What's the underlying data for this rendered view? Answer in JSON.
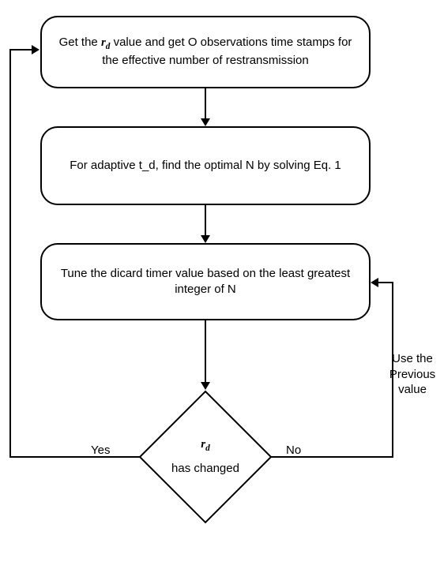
{
  "chart_data": {
    "type": "flowchart",
    "nodes": [
      {
        "id": "n1",
        "type": "process",
        "text_key": "nodes.n1"
      },
      {
        "id": "n2",
        "type": "process",
        "text_key": "nodes.n2"
      },
      {
        "id": "n3",
        "type": "process",
        "text_key": "nodes.n3"
      },
      {
        "id": "d1",
        "type": "decision",
        "text_key": "nodes.d1"
      }
    ],
    "edges": [
      {
        "from": "n1",
        "to": "n2"
      },
      {
        "from": "n2",
        "to": "n3"
      },
      {
        "from": "n3",
        "to": "d1"
      },
      {
        "from": "d1",
        "to": "n1",
        "label_key": "labels.yes"
      },
      {
        "from": "d1",
        "to": "n3",
        "label_key": "labels.no",
        "side_label_key": "labels.use_prev"
      }
    ]
  },
  "symbols": {
    "rd_base": "r",
    "rd_sub": "d"
  },
  "nodes": {
    "n1_pre": "Get the ",
    "n1_post": " value and get O observations time stamps for the effective number of restransmission",
    "n2": "For adaptive t_d, find the optimal N by solving Eq. 1",
    "n3": "Tune the dicard timer value based on the least greatest integer of N",
    "d1_line2": "has changed"
  },
  "labels": {
    "yes": "Yes",
    "no": "No",
    "use_prev": "Use the\nPrevious\nvalue"
  }
}
